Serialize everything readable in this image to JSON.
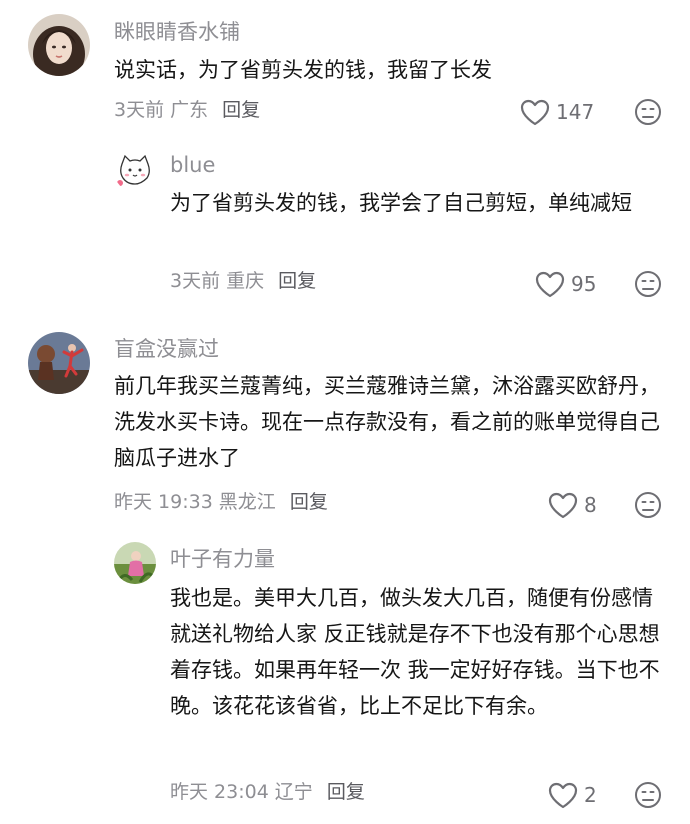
{
  "comments": [
    {
      "username": "眯眼睛香水铺",
      "content": "说实话，为了省剪头发的钱，我留了长发",
      "time": "3天前",
      "region": "广东",
      "reply_label": "回复",
      "likes": "147",
      "replies": [
        {
          "username": "blue",
          "content": "为了省剪头发的钱，我学会了自己剪短，单纯减短",
          "time": "3天前",
          "region": "重庆",
          "reply_label": "回复",
          "likes": "95"
        }
      ]
    },
    {
      "username": "盲盒没赢过",
      "content": "前几年我买兰蔻菁纯，买兰蔻雅诗兰黛，沐浴露买欧舒丹，洗发水买卡诗。现在一点存款没有，看之前的账单觉得自己脑瓜子进水了",
      "time": "昨天 19:33",
      "region": "黑龙江",
      "reply_label": "回复",
      "likes": "8",
      "replies": [
        {
          "username": "叶子有力量",
          "content": "我也是。美甲大几百，做头发大几百，随便有份感情就送礼物给人家 反正钱就是存不下也没有那个心思想着存钱。如果再年轻一次 我一定好好存钱。当下也不晚。该花花该省省，比上不足比下有余。",
          "time": "昨天 23:04",
          "region": "辽宁",
          "reply_label": "回复",
          "likes": "2"
        }
      ]
    }
  ],
  "icons": {
    "like": "heart-outline-icon",
    "dislike": "frown-face-icon"
  },
  "colors": {
    "username": "#8e8e93",
    "content": "#161616",
    "meta": "#8e8e93",
    "icon": "#6e6e73"
  }
}
